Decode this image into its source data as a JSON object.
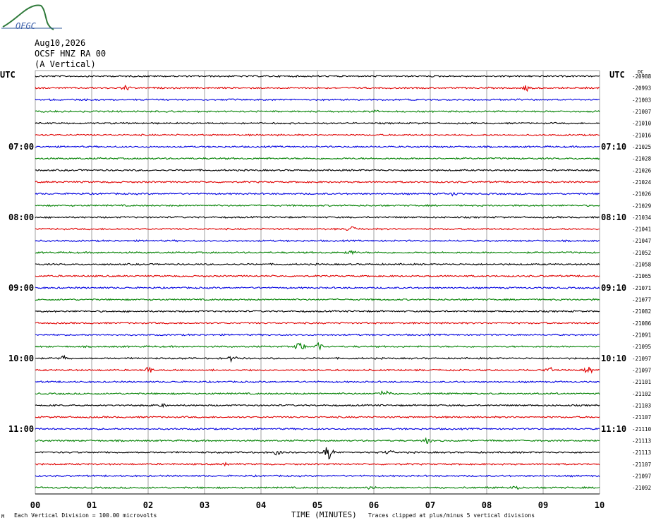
{
  "logo": {
    "text": "OFGC"
  },
  "header": {
    "date": "Aug10,2026",
    "station": "OCSF HNZ RA 00",
    "component": "(A Vertical)"
  },
  "left_axis_label": "UTC",
  "right_axis_label": "UTC",
  "right_unit": "DC",
  "footer": {
    "scale_prefix": "Μ",
    "scale_note": "Each Vertical Division = 100.00 microvolts",
    "xlabel": "TIME (MINUTES)",
    "clip_note": "Traces clipped at plus/minus 5 vertical divisions"
  },
  "colors": {
    "trace_cycle": [
      "#000000",
      "#e00000",
      "#0000e0",
      "#008000"
    ],
    "grid": "#a0a0a0"
  },
  "chart_data": {
    "type": "line",
    "title": "OCSF HNZ RA 00",
    "xlabel": "TIME (MINUTES)",
    "ylabel": "UTC",
    "grid": true,
    "xlim": [
      0,
      10
    ],
    "x_ticks": [
      "00",
      "01",
      "02",
      "03",
      "04",
      "05",
      "06",
      "07",
      "08",
      "09",
      "10"
    ],
    "left_hour_labels": [
      {
        "row": 6,
        "label": "07:00"
      },
      {
        "row": 12,
        "label": "08:00"
      },
      {
        "row": 18,
        "label": "09:00"
      },
      {
        "row": 24,
        "label": "10:00"
      },
      {
        "row": 30,
        "label": "11:00"
      }
    ],
    "right_hour_labels": [
      {
        "row": 6,
        "label": "07:10"
      },
      {
        "row": 12,
        "label": "08:10"
      },
      {
        "row": 18,
        "label": "09:10"
      },
      {
        "row": 24,
        "label": "10:10"
      },
      {
        "row": 30,
        "label": "11:10"
      }
    ],
    "dc_offsets": [
      -20988,
      -20993,
      -21003,
      -21007,
      -21010,
      -21016,
      -21025,
      -21028,
      -21026,
      -21024,
      -21026,
      -21029,
      -21034,
      -21041,
      -21047,
      -21052,
      -21058,
      -21065,
      -21071,
      -21077,
      -21082,
      -21086,
      -21091,
      -21095,
      -21097,
      -21097,
      -21101,
      -21102,
      -21103,
      -21107,
      -21110,
      -21113,
      -21113,
      -21107,
      -21097,
      -21092
    ],
    "events": [
      {
        "row": 1,
        "minute": 1.6,
        "amp": 3
      },
      {
        "row": 1,
        "minute": 8.7,
        "amp": 3
      },
      {
        "row": 3,
        "minute": 6.0,
        "amp": 1
      },
      {
        "row": 10,
        "minute": 7.4,
        "amp": 2
      },
      {
        "row": 13,
        "minute": 5.6,
        "amp": 3
      },
      {
        "row": 15,
        "minute": 5.6,
        "amp": 2
      },
      {
        "row": 23,
        "minute": 4.7,
        "amp": 6
      },
      {
        "row": 23,
        "minute": 5.0,
        "amp": 5
      },
      {
        "row": 24,
        "minute": 3.5,
        "amp": 4
      },
      {
        "row": 24,
        "minute": 0.5,
        "amp": 3
      },
      {
        "row": 25,
        "minute": 2.0,
        "amp": 4
      },
      {
        "row": 25,
        "minute": 9.1,
        "amp": 4
      },
      {
        "row": 25,
        "minute": 9.8,
        "amp": 4
      },
      {
        "row": 27,
        "minute": 6.2,
        "amp": 4
      },
      {
        "row": 28,
        "minute": 2.3,
        "amp": 2
      },
      {
        "row": 31,
        "minute": 6.95,
        "amp": 4
      },
      {
        "row": 32,
        "minute": 4.3,
        "amp": 5
      },
      {
        "row": 32,
        "minute": 5.2,
        "amp": 9
      },
      {
        "row": 32,
        "minute": 6.3,
        "amp": 3
      },
      {
        "row": 33,
        "minute": 3.4,
        "amp": 2
      },
      {
        "row": 35,
        "minute": 5.95,
        "amp": 3
      },
      {
        "row": 35,
        "minute": 8.5,
        "amp": 2
      }
    ]
  }
}
